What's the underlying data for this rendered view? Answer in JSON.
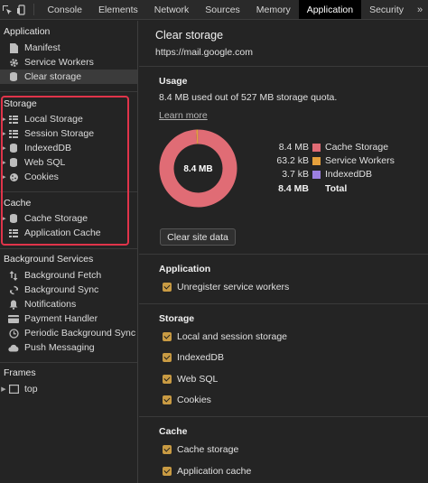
{
  "tabs": {
    "items": [
      {
        "label": "Console",
        "active": false
      },
      {
        "label": "Elements",
        "active": false
      },
      {
        "label": "Network",
        "active": false
      },
      {
        "label": "Sources",
        "active": false
      },
      {
        "label": "Memory",
        "active": false
      },
      {
        "label": "Application",
        "active": true
      },
      {
        "label": "Security",
        "active": false
      }
    ],
    "more": "»"
  },
  "sidebar": {
    "application": {
      "title": "Application",
      "items": [
        {
          "label": "Manifest",
          "icon": "file-icon"
        },
        {
          "label": "Service Workers",
          "icon": "gear-icon"
        },
        {
          "label": "Clear storage",
          "icon": "database-icon",
          "selected": true
        }
      ]
    },
    "storage": {
      "title": "Storage",
      "items": [
        {
          "label": "Local Storage",
          "icon": "grid-icon"
        },
        {
          "label": "Session Storage",
          "icon": "grid-icon"
        },
        {
          "label": "IndexedDB",
          "icon": "database-icon"
        },
        {
          "label": "Web SQL",
          "icon": "database-icon"
        },
        {
          "label": "Cookies",
          "icon": "cookie-icon"
        }
      ]
    },
    "cache": {
      "title": "Cache",
      "items": [
        {
          "label": "Cache Storage",
          "icon": "database-icon"
        },
        {
          "label": "Application Cache",
          "icon": "grid-icon"
        }
      ]
    },
    "background": {
      "title": "Background Services",
      "items": [
        {
          "label": "Background Fetch",
          "icon": "arrows-updown-icon"
        },
        {
          "label": "Background Sync",
          "icon": "sync-icon"
        },
        {
          "label": "Notifications",
          "icon": "bell-icon"
        },
        {
          "label": "Payment Handler",
          "icon": "card-icon"
        },
        {
          "label": "Periodic Background Sync",
          "icon": "clock-icon"
        },
        {
          "label": "Push Messaging",
          "icon": "cloud-icon"
        }
      ]
    },
    "frames": {
      "title": "Frames",
      "items": [
        {
          "label": "top",
          "icon": "frame-icon"
        }
      ]
    }
  },
  "main": {
    "title": "Clear storage",
    "url": "https://mail.google.com",
    "usage": {
      "heading": "Usage",
      "quota_text": "8.4 MB used out of 527 MB storage quota.",
      "learn_more": "Learn more",
      "donut_label": "8.4 MB",
      "legend": [
        {
          "value": "8.4 MB",
          "label": "Cache Storage",
          "color": "#e06c75"
        },
        {
          "value": "63.2 kB",
          "label": "Service Workers",
          "color": "#e5a03c"
        },
        {
          "value": "3.7 kB",
          "label": "IndexedDB",
          "color": "#9c7fe0"
        }
      ],
      "total": {
        "value": "8.4 MB",
        "label": "Total"
      }
    },
    "clear_button": "Clear site data",
    "application": {
      "heading": "Application",
      "options": [
        {
          "label": "Unregister service workers",
          "checked": true
        }
      ]
    },
    "storage": {
      "heading": "Storage",
      "options": [
        {
          "label": "Local and session storage",
          "checked": true
        },
        {
          "label": "IndexedDB",
          "checked": true
        },
        {
          "label": "Web SQL",
          "checked": true
        },
        {
          "label": "Cookies",
          "checked": true
        }
      ]
    },
    "cache": {
      "heading": "Cache",
      "options": [
        {
          "label": "Cache storage",
          "checked": true
        },
        {
          "label": "Application cache",
          "checked": true
        }
      ]
    }
  },
  "chart_data": {
    "type": "pie",
    "categories": [
      "Cache Storage",
      "Service Workers",
      "IndexedDB"
    ],
    "values": [
      8400,
      63.2,
      3.7
    ],
    "units": "kB"
  }
}
